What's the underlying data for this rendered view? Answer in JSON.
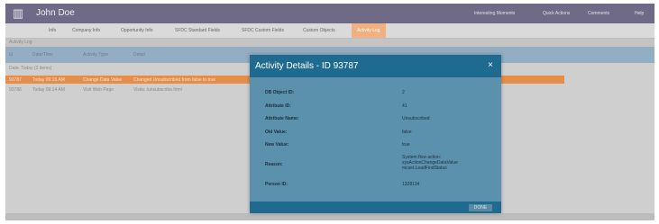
{
  "header": {
    "username": "John Doe",
    "links": [
      "Interesting Moments",
      "Quick Actions",
      "Comments",
      "Help"
    ]
  },
  "tabs": [
    "Info",
    "Company Info",
    "Opportunity Info",
    "SFDC Standard Fields",
    "SFDC Custom Fields",
    "Custom Objects",
    "Activity Log"
  ],
  "subbar": "Activity Log",
  "table": {
    "headers": [
      "Id",
      "Date/Time",
      "Activity Type",
      "Detail"
    ],
    "group_label": "Date: Today (2 items)",
    "rows": [
      {
        "id": "93787",
        "datetime": "Today 09:15 AM",
        "type": "Change Data Value",
        "detail": "Changed Unsubscribed from false to true"
      },
      {
        "id": "93786",
        "datetime": "Today 09:14 AM",
        "type": "Visit Web Page",
        "detail": "Visits: /unsubscribe.html"
      }
    ]
  },
  "modal": {
    "title": "Activity Details - ID 93787",
    "close_icon": "×",
    "fields": [
      {
        "label": "DB Object ID:",
        "value": "2"
      },
      {
        "label": "Attribute ID:",
        "value": "41"
      },
      {
        "label": "Attribute Name:",
        "value": "Unsubscribed"
      },
      {
        "label": "Old Value:",
        "value": "false"
      },
      {
        "label": "New Value:",
        "value": "true"
      },
      {
        "label": "Reason:",
        "value": "System flow action: sysActionChangeDataValue mcset.LeadFindStatus"
      },
      {
        "label": "Person ID:",
        "value": "1328134"
      }
    ],
    "done_label": "DONE"
  }
}
